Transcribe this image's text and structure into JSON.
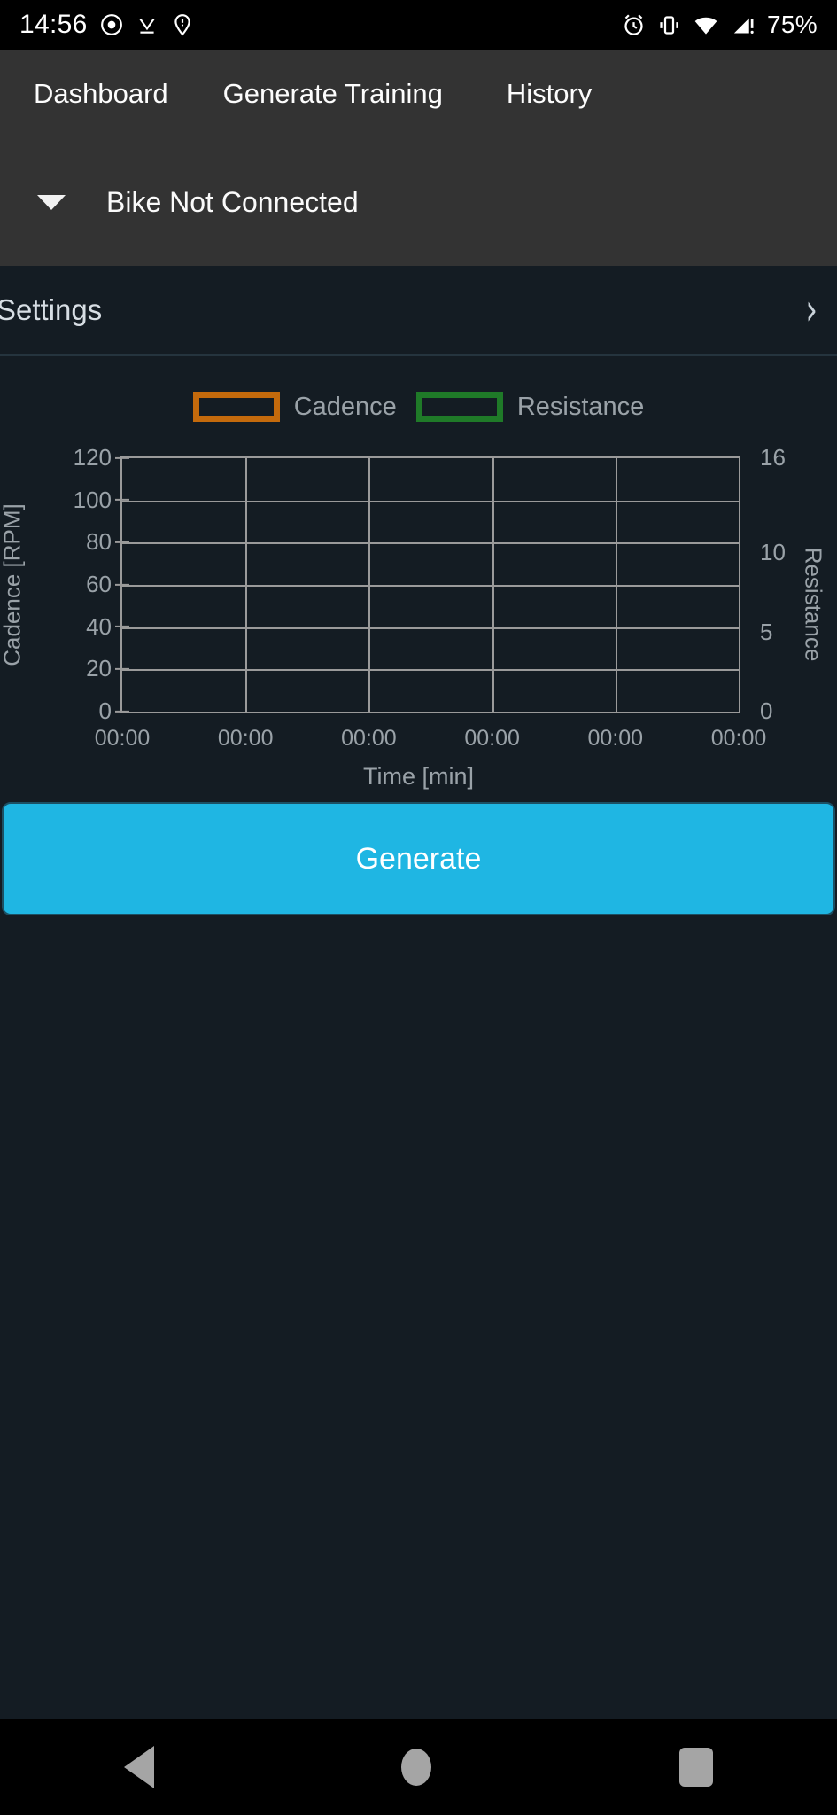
{
  "status_bar": {
    "time": "14:56",
    "battery": "75%",
    "left_icons": [
      "record-dot-icon",
      "download-check-icon",
      "location-pin-icon"
    ],
    "right_icons": [
      "alarm-clock-icon",
      "vibrate-icon",
      "wifi-icon",
      "signal-warning-icon"
    ]
  },
  "tabs": [
    {
      "label": "Dashboard"
    },
    {
      "label": "Generate Training"
    },
    {
      "label": "History"
    }
  ],
  "connection": {
    "status_label": "Bike Not Connected",
    "dropdown_icon": "chevron-down-icon"
  },
  "settings": {
    "label": "Settings",
    "chevron_icon": "chevron-right-icon"
  },
  "generate": {
    "label": "Generate",
    "color": "#1fb6e3"
  },
  "nav_bar": {
    "back": "back-triangle-icon",
    "home": "home-circle-icon",
    "recents": "recents-square-icon"
  },
  "colors": {
    "accent": "#1fb6e3",
    "cadence": "#c46a0c",
    "resistance": "#1f7a28",
    "background": "#141c23",
    "appbar": "#333333",
    "grid": "#9a9a9a",
    "muted_text": "#9aa2a8"
  },
  "chart_data": {
    "type": "line",
    "title": "",
    "xlabel": "Time [min]",
    "ylabel": "Cadence [RPM]",
    "y2label": "Resistance",
    "grid": true,
    "legend_position": "top",
    "legend": [
      {
        "name": "Cadence",
        "color": "#c46a0c"
      },
      {
        "name": "Resistance",
        "color": "#1f7a28"
      }
    ],
    "ylim": [
      0,
      120
    ],
    "yticks": [
      120,
      100,
      80,
      60,
      40,
      20,
      0
    ],
    "ytick_labels": [
      "120",
      "100",
      "80",
      "60",
      "40",
      "20",
      "0"
    ],
    "y2lim": [
      0,
      16
    ],
    "y2ticks": [
      16,
      10,
      5,
      0
    ],
    "y2tick_labels": [
      "16",
      "10",
      "5",
      "0"
    ],
    "xtick_labels": [
      "00:00",
      "00:00",
      "00:00",
      "00:00",
      "00:00",
      "00:00"
    ],
    "series": [
      {
        "name": "Cadence",
        "axis": "left",
        "color": "#c46a0c",
        "x": [],
        "values": []
      },
      {
        "name": "Resistance",
        "axis": "right",
        "color": "#1f7a28",
        "x": [],
        "values": []
      }
    ]
  }
}
